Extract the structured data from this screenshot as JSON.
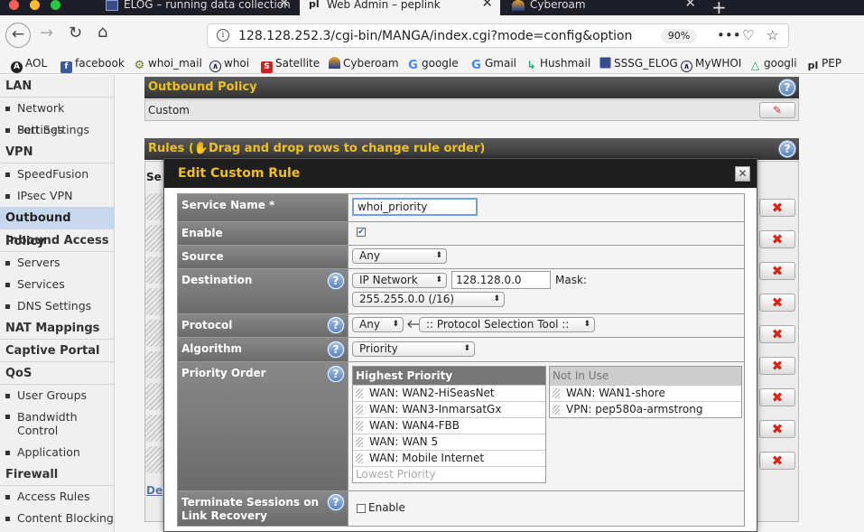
{
  "browser": {
    "tabs": [
      {
        "label": "ELOG – running data collection"
      },
      {
        "label": "Web Admin – peplink"
      },
      {
        "label": "Cyberoam"
      }
    ],
    "url": "128.128.252.3/cgi-bin/MANGA/index.cgi?mode=config&option",
    "zoom": "90%",
    "bookmarks": [
      "AOL",
      "facebook",
      "whoi_mail",
      "whoi",
      "Satellite",
      "Cyberoam",
      "google",
      "Gmail",
      "Hushmail",
      "SSSG_ELOG",
      "MyWHOI",
      "googli",
      "PEP"
    ],
    "colors": {
      "tabbar": "#1e1e28",
      "toolbar": "#f4f4f4"
    }
  },
  "sidebar": {
    "groups": [
      {
        "title": "LAN",
        "items": [
          "Network Settings",
          "Port Settings"
        ]
      },
      {
        "title": "VPN",
        "items": [
          "SpeedFusion",
          "IPsec VPN"
        ]
      },
      {
        "title": "Outbound Policy",
        "items": []
      },
      {
        "title": "Inbound Access",
        "items": [
          "Servers",
          "Services",
          "DNS Settings"
        ]
      },
      {
        "title": "NAT Mappings",
        "items": []
      },
      {
        "title": "Captive Portal",
        "items": []
      },
      {
        "title": "QoS",
        "items": [
          "User Groups",
          "Bandwidth Control",
          "Application"
        ]
      },
      {
        "title": "Firewall",
        "items": [
          "Access Rules",
          "Content Blocking"
        ]
      }
    ],
    "active": "Outbound Policy"
  },
  "main": {
    "outbound_title": "Outbound Policy",
    "outbound_value": "Custom",
    "rules_title": "Rules",
    "rules_hint": "Drag and drop rows to change rule order)",
    "rules_col_fragment": "Se",
    "rules_bottom_fragment": "De"
  },
  "modal": {
    "title": "Edit Custom Rule",
    "service_name_label": "Service Name *",
    "service_name_value": "whoi_priority",
    "enable_label": "Enable",
    "enable_checked": true,
    "source_label": "Source",
    "source_value": "Any",
    "destination_label": "Destination",
    "destination_type": "IP Network",
    "destination_ip": "128.128.0.0",
    "mask_label": "Mask:",
    "mask_value": "255.255.0.0 (/16)",
    "protocol_label": "Protocol",
    "protocol_value": "Any",
    "protocol_tool": ":: Protocol Selection Tool ::",
    "algorithm_label": "Algorithm",
    "algorithm_value": "Priority",
    "priority_order_label": "Priority Order",
    "highest_priority": "Highest Priority",
    "lowest_priority": "Lowest Priority",
    "priority_items": [
      "WAN: WAN2-HiSeasNet",
      "WAN: WAN3-InmarsatGx",
      "WAN: WAN4-FBB",
      "WAN: WAN 5",
      "WAN: Mobile Internet"
    ],
    "not_in_use": "Not In Use",
    "not_in_use_items": [
      "WAN: WAN1-shore",
      "VPN: pep580a-armstrong"
    ],
    "terminate_label": "Terminate Sessions on Link Recovery",
    "terminate_enable": "Enable",
    "accent": "#f0c020"
  }
}
